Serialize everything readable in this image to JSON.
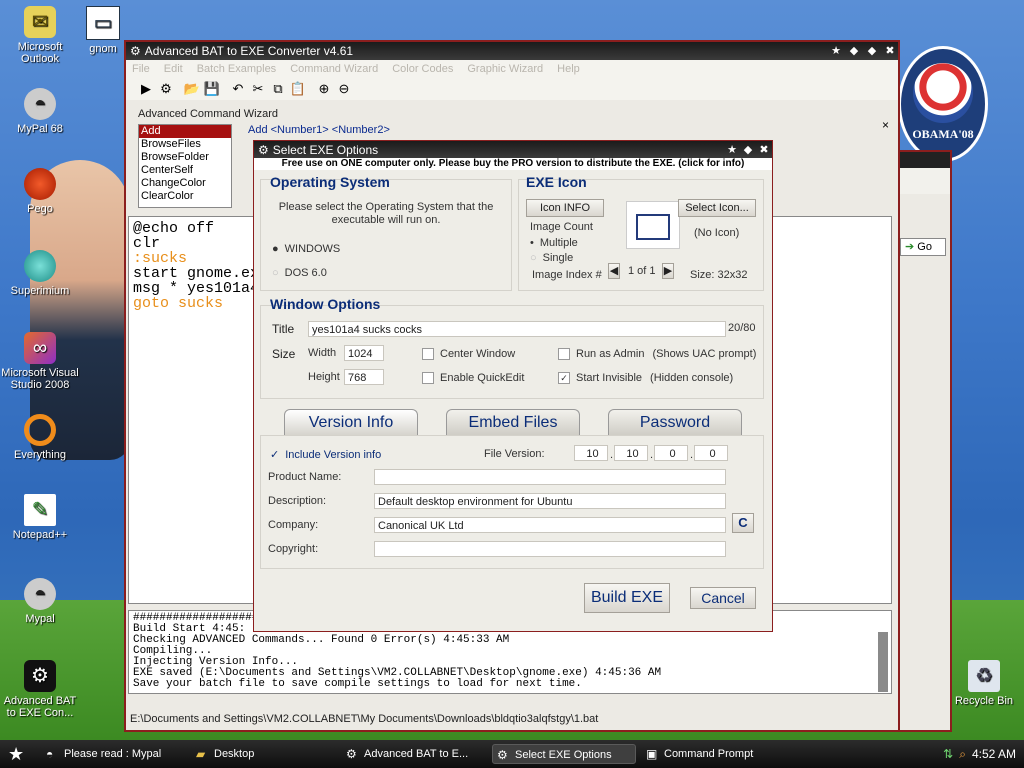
{
  "desktop": {
    "icons": [
      {
        "label": "Microsoft Outlook",
        "icon": "outlook-icon",
        "glyph": "✉"
      },
      {
        "label": "gnom",
        "icon": "window-icon",
        "glyph": "▭"
      },
      {
        "label": "MyPal 68",
        "icon": "raccoon-icon",
        "glyph": "🦝"
      },
      {
        "label": "Pego",
        "icon": "ball-icon",
        "glyph": "●"
      },
      {
        "label": "Superimium",
        "icon": "chrome-icon",
        "glyph": "◉"
      },
      {
        "label": "Microsoft Visual Studio 2008",
        "icon": "visual-studio-icon",
        "glyph": "∞"
      },
      {
        "label": "Everything",
        "icon": "search-ring-icon",
        "glyph": "○"
      },
      {
        "label": "Notepad++",
        "icon": "notepad-icon",
        "glyph": "✎"
      },
      {
        "label": "Mypal",
        "icon": "raccoon-icon",
        "glyph": "🦝"
      },
      {
        "label": "Advanced BAT to EXE Con...",
        "icon": "bat-exe-icon",
        "glyph": "⚙"
      },
      {
        "label": "Recycle Bin",
        "icon": "recycle-bin-icon",
        "glyph": "🗑"
      }
    ],
    "poster_text": "OBAMA'08",
    "go_label": "Go"
  },
  "mainwin": {
    "title": "Advanced BAT to EXE Converter v4.61",
    "menu": [
      "File",
      "Edit",
      "Batch Examples",
      "Command Wizard",
      "Color Codes",
      "Graphic Wizard",
      "Help"
    ],
    "wizard_label": "Advanced Command Wizard",
    "commands": [
      "Add",
      "BrowseFiles",
      "BrowseFolder",
      "CenterSelf",
      "ChangeColor",
      "ClearColor"
    ],
    "syntax": "Add  <Number1> <Number2>",
    "close_x": "×",
    "code": [
      "@echo off",
      "clr",
      ":sucks",
      "start gnome.ex",
      "msg * yes101a4",
      "goto sucks"
    ],
    "output": [
      "##########################",
      "Build Start 4:45:",
      "Checking ADVANCED Commands...  Found 0 Error(s) 4:45:33 AM",
      "Compiling...",
      "Injecting Version Info...",
      "EXE saved (E:\\Documents and Settings\\VM2.COLLABNET\\Desktop\\gnome.exe) 4:45:36 AM",
      "Save your batch file to save compile settings to load for next time."
    ],
    "status_path": "E:\\Documents and Settings\\VM2.COLLABNET\\My Documents\\Downloads\\bldqtio3alqfstgy\\1.bat"
  },
  "dialog": {
    "title": "Select EXE Options",
    "promo": "Free use on ONE computer only. Please buy the PRO version to distribute the EXE. (click for info)",
    "os": {
      "heading": "Operating System",
      "prompt": "Please select the Operating System that the executable will run on.",
      "options": [
        "WINDOWS",
        "DOS 6.0"
      ],
      "selected": "WINDOWS"
    },
    "exe_icon": {
      "heading": "EXE Icon",
      "icon_info_label": "Icon INFO",
      "select_icon_label": "Select Icon...",
      "image_count_label": "Image Count",
      "count_options": [
        "Multiple",
        "Single"
      ],
      "selected_count": "Multiple",
      "image_index_label": "Image Index #",
      "index_value": "1 of 1",
      "no_icon": "(No Icon)",
      "size": "Size:  32x32"
    },
    "window_options": {
      "heading": "Window Options",
      "title_label": "Title",
      "title_value": "yes101a4 sucks cocks",
      "title_count": "20/80",
      "size_label": "Size",
      "width_label": "Width",
      "width_value": "1024",
      "height_label": "Height",
      "height_value": "768",
      "center_window": "Center Window",
      "enable_quickedit": "Enable QuickEdit",
      "run_as_admin": "Run as Admin",
      "run_as_admin_note": "(Shows UAC prompt)",
      "start_invisible": "Start Invisible",
      "start_invisible_note": "(Hidden console)",
      "start_invisible_checked": "✓"
    },
    "tabs": [
      "Version Info",
      "Embed Files",
      "Password"
    ],
    "version": {
      "include_label": "Include Version info",
      "include_checked": "✓",
      "file_version_label": "File Version:",
      "file_version": [
        "10",
        "10",
        "0",
        "0"
      ],
      "dots": [
        ".",
        " .",
        "."
      ],
      "product_name_label": "Product Name:",
      "product_name": "",
      "description_label": "Description:",
      "description": "Default desktop environment for Ubuntu",
      "company_label": "Company:",
      "company": "Canonical UK Ltd",
      "copyright_btn": "C",
      "copyright_label": "Copyright:",
      "copyright": ""
    },
    "build_label": "Build EXE",
    "cancel_label": "Cancel"
  },
  "taskbar": {
    "tasks": [
      {
        "label": "Please read : Mypal",
        "icon": "raccoon-icon"
      },
      {
        "label": "Desktop",
        "icon": "folder-icon"
      },
      {
        "label": "Advanced BAT to E...",
        "icon": "bat-exe-icon"
      },
      {
        "label": "Select EXE Options",
        "icon": "bat-exe-icon"
      },
      {
        "label": "Command Prompt",
        "icon": "console-icon"
      }
    ],
    "active_task": "Select EXE Options",
    "clock": "4:52 AM"
  }
}
